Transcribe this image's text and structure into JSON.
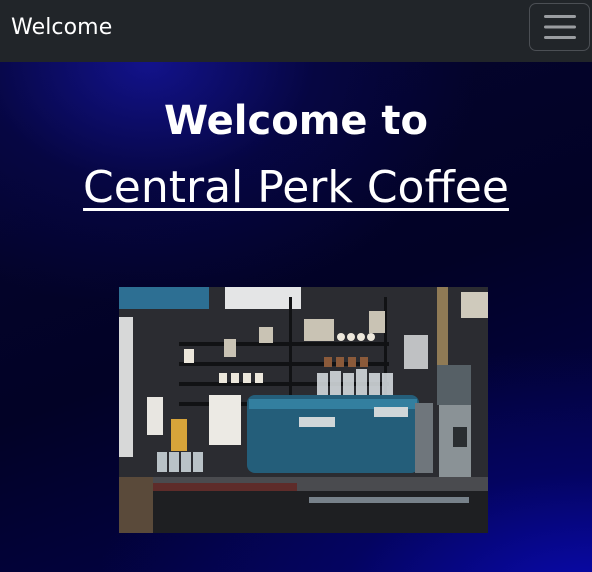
{
  "navbar": {
    "brand": "Welcome",
    "toggler_icon": "hamburger-menu-icon"
  },
  "hero": {
    "heading_line1": "Welcome to",
    "heading_line2": "Central Perk Coffee",
    "image": "coffee-bar-espresso-machine-photo"
  },
  "colors": {
    "navbar_bg": "#212529",
    "hero_bg": "#03034a",
    "text": "#ffffff"
  }
}
